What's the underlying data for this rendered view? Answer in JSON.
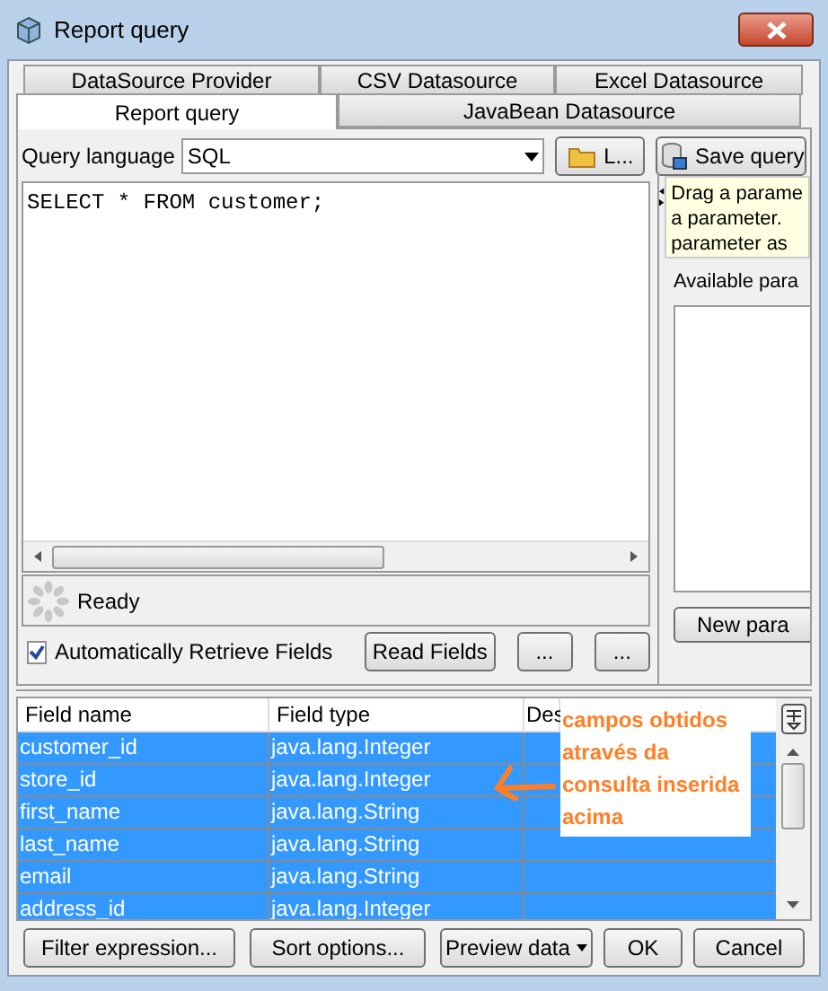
{
  "window": {
    "title": "Report query"
  },
  "tabs_back": [
    {
      "label": "DataSource Provider",
      "selected": false
    },
    {
      "label": "CSV Datasource",
      "selected": false
    },
    {
      "label": "Excel Datasource",
      "selected": false
    }
  ],
  "tabs_front": [
    {
      "label": "Report query",
      "selected": true
    },
    {
      "label": "JavaBean Datasource",
      "selected": false
    }
  ],
  "query_language": {
    "label": "Query language",
    "value": "SQL"
  },
  "load_button": "L...",
  "save_button": "Save query",
  "query": "SELECT * FROM customer;",
  "status": "Ready",
  "auto_retrieve": {
    "label": "Automatically Retrieve Fields",
    "checked": true
  },
  "read_fields_button": "Read Fields",
  "more_buttons": [
    "...",
    "..."
  ],
  "hint_lines": [
    "Drag a parame",
    "a parameter.",
    "parameter as"
  ],
  "parameters_label": "Available para",
  "new_parameter_button": "New para",
  "table": {
    "columns": [
      "Field name",
      "Field type",
      "Des"
    ],
    "rows": [
      {
        "cells": [
          "customer_id",
          "java.lang.Integer"
        ],
        "selected": true
      },
      {
        "cells": [
          "store_id",
          "java.lang.Integer"
        ],
        "selected": true
      },
      {
        "cells": [
          "first_name",
          "java.lang.String"
        ],
        "selected": true
      },
      {
        "cells": [
          "last_name",
          "java.lang.String"
        ],
        "selected": true
      },
      {
        "cells": [
          "email",
          "java.lang.String"
        ],
        "selected": true
      },
      {
        "cells": [
          "address_id",
          "java.lang.Integer"
        ],
        "selected": true
      }
    ]
  },
  "annotation": "campos obtidos através da consulta inserida acima",
  "bottom_buttons": [
    "Filter expression...",
    "Sort options...",
    "Preview data"
  ],
  "dialog_buttons": [
    "OK",
    "Cancel"
  ]
}
